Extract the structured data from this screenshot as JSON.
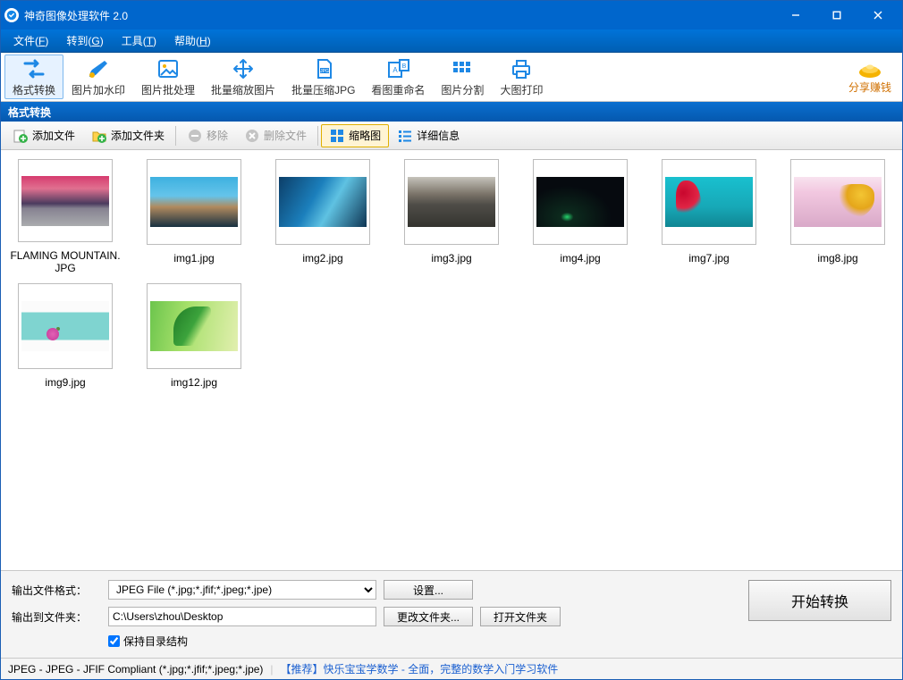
{
  "title": "神奇图像处理软件 2.0",
  "menu": {
    "file": "文件(",
    "file_k": "F",
    "go": "转到(",
    "go_k": "G",
    "tool": "工具(",
    "tool_k": "T",
    "help": "帮助(",
    "help_k": "H",
    "close_paren": ")"
  },
  "toolbar": {
    "fmt": "格式转换",
    "watermark": "图片加水印",
    "batch": "图片批处理",
    "resize": "批量缩放图片",
    "compress": "批量压缩JPG",
    "rename": "看图重命名",
    "split": "图片分割",
    "print": "大图打印",
    "share": "分享赚钱"
  },
  "section": "格式转换",
  "ft": {
    "add_file": "添加文件",
    "add_folder": "添加文件夹",
    "remove": "移除",
    "remove_file": "删除文件",
    "thumb": "缩略图",
    "detail": "详细信息"
  },
  "thumbs": [
    {
      "cap": "FLAMING MOUNTAIN.JPG",
      "cls": "photo-0"
    },
    {
      "cap": "img1.jpg",
      "cls": "photo-1"
    },
    {
      "cap": "img2.jpg",
      "cls": "photo-2"
    },
    {
      "cap": "img3.jpg",
      "cls": "photo-3"
    },
    {
      "cap": "img4.jpg",
      "cls": "photo-4"
    },
    {
      "cap": "img7.jpg",
      "cls": "photo-5"
    },
    {
      "cap": "img8.jpg",
      "cls": "photo-6"
    },
    {
      "cap": "img9.jpg",
      "cls": "photo-7"
    },
    {
      "cap": "img12.jpg",
      "cls": "photo-8"
    }
  ],
  "form": {
    "out_fmt_label": "输出文件格式：",
    "out_fmt_value": "JPEG File (*.jpg;*.jfif;*.jpeg;*.jpe)",
    "settings": "设置...",
    "out_dir_label": "输出到文件夹：",
    "out_dir_value": "C:\\Users\\zhou\\Desktop",
    "change_dir": "更改文件夹...",
    "open_dir": "打开文件夹",
    "keep_struct": "保持目录结构",
    "start": "开始转换"
  },
  "status": {
    "fmt": "JPEG - JPEG - JFIF Compliant (*.jpg;*.jfif;*.jpeg;*.jpe)",
    "promo": "【推荐】快乐宝宝学数学 - 全面，完整的数学入门学习软件"
  }
}
